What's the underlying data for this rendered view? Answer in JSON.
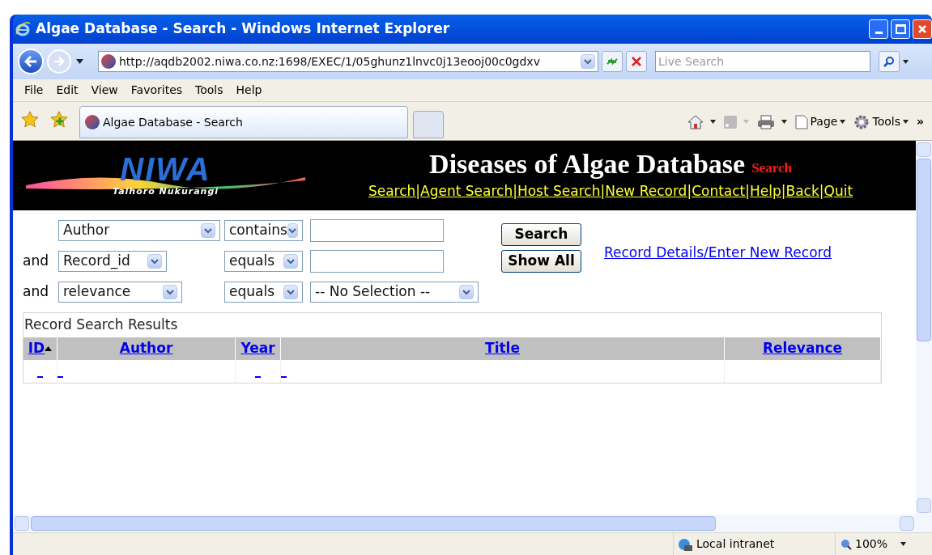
{
  "window": {
    "title": "Algae Database - Search - Windows Internet Explorer"
  },
  "address_bar": {
    "url": "http://aqdb2002.niwa.co.nz:1698/EXEC/1/05ghunz1lnvc0j13eooj00c0gdxv"
  },
  "search": {
    "placeholder": "Live Search"
  },
  "menu": [
    "File",
    "Edit",
    "View",
    "Favorites",
    "Tools",
    "Help"
  ],
  "tabs": [
    {
      "label": "Algae Database - Search",
      "selected": true
    }
  ],
  "command_bar": [
    {
      "kind": "home"
    },
    {
      "kind": "feeds"
    },
    {
      "kind": "print"
    },
    {
      "kind": "page",
      "label": "Page"
    },
    {
      "kind": "tools",
      "label": "Tools"
    },
    {
      "kind": "more",
      "label": "»"
    }
  ],
  "header": {
    "logo": "NIWA",
    "logo_tagline": "Taihoro Nukurangi",
    "title": "Diseases of Algae Database",
    "subtitle": "Search",
    "links": [
      "Search|",
      "Agent Search|",
      "Host Search|",
      "New Record|",
      "Contact|",
      "Help|",
      "Back|",
      "Quit"
    ]
  },
  "filters": [
    {
      "field": "Author",
      "operator": "contains",
      "value": {
        "kind": "text"
      }
    },
    {
      "connector": "and",
      "field": "Record_id",
      "operator": "equals",
      "value": {
        "kind": "text"
      }
    },
    {
      "connector": "and",
      "field": "relevance",
      "operator": "equals",
      "value": {
        "kind": "select",
        "text": "-- No Selection --"
      }
    }
  ],
  "buttons": [
    "Search",
    "Show All"
  ],
  "record_link": "Record Details/Enter New Record",
  "results": {
    "caption": "Record Search Results",
    "columns": [
      {
        "label": "ID",
        "sorted": true
      },
      {
        "label": "Author",
        "sorted": false
      },
      {
        "label": "Year",
        "sorted": false
      },
      {
        "label": "Title",
        "sorted": false
      },
      {
        "label": "Relevance",
        "sorted": false
      }
    ],
    "rows": [
      {
        "cells": [
          {
            "empty_link": true
          },
          {
            "empty_link": true
          },
          {
            "empty_link": true
          },
          {
            "empty_link": true
          },
          {
            "empty_link": false
          }
        ]
      }
    ]
  },
  "status_bar": {
    "zone": "Local intranet",
    "zoom": "100%"
  }
}
